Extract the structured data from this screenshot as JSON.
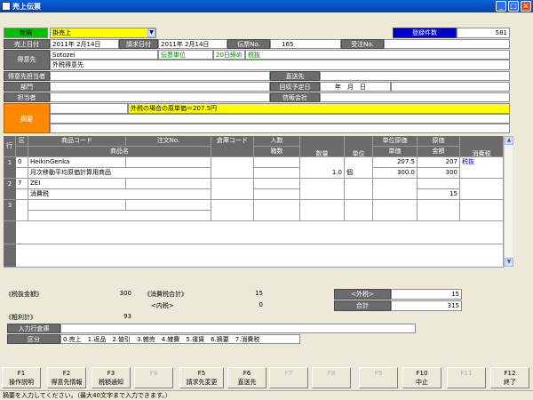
{
  "window": {
    "title": "売上伝票",
    "min": "_",
    "max": "□",
    "close": "×"
  },
  "header": {
    "mode": "新規",
    "type_value": "掛売上",
    "reg_count_label": "登録件数",
    "reg_count": "581",
    "sale_date_label": "売上日付",
    "sale_date": "2011年 2月14日",
    "bill_date_label": "請求日付",
    "bill_date": "2011年 2月14日",
    "slip_no_label": "伝票No.",
    "slip_no": "165",
    "order_no_label": "受注No.",
    "customer_label": "得意先",
    "customer_code": "Sotozei",
    "customer_unit": "伝票単位",
    "customer_close": "20日締め",
    "customer_tax": "税抜",
    "customer_name": "外税得意先",
    "contact_label": "得意先担当者",
    "dept_label": "部門",
    "staff_label": "担当者",
    "ship_label": "直送先",
    "collect_label": "回収予定日",
    "collect_value": "年　月　日",
    "trust_label": "信販会社",
    "memo_label": "摘要",
    "memo_text": "外税の場合の原単価＝207.5円"
  },
  "grid": {
    "h_row": "行",
    "h_kubun": "区",
    "h_code": "商品コード",
    "h_order": "注文No.",
    "h_name": "商品名",
    "h_warehouse": "倉庫コード",
    "h_irisu": "入数",
    "h_hako": "箱数",
    "h_qty": "数量",
    "h_unit": "単位",
    "h_unitcost_top": "単位原価",
    "h_unitcost_bot": "単価",
    "h_cost_top": "原価",
    "h_cost_bot": "金額",
    "h_tax": "消費税",
    "rows": [
      {
        "no": "1",
        "kubun": "0",
        "code": "HeikinGenka",
        "name": "月次移動平均原価計算用商品",
        "qty": "1.0",
        "unit": "個",
        "cost1": "207.5",
        "price": "300.0",
        "cost2": "207",
        "amount": "300",
        "tax": "税抜"
      },
      {
        "no": "2",
        "kubun": "7",
        "code": "ZEI",
        "name": "消費税",
        "amount": "15"
      },
      {
        "no": "3"
      }
    ]
  },
  "summary": {
    "taxex_label": "《税抜金額》",
    "taxex_value": "300",
    "taxsum_label": "《消費税合計》",
    "taxsum_value": "15",
    "intax_label": "<内税>",
    "intax_value": "0",
    "outtax_label": "<外税>",
    "outtax_value": "15",
    "total_label": "合計",
    "total_value": "315",
    "profit_label": "《粗利計》",
    "profit_value": "93",
    "inwh_label": "入力行倉庫",
    "kubun_label": "区分",
    "kubun_text": "0.売上　1.返品　2.値引　3.雑売　4.雑費　5.運賃　6.摘要　7.消費税"
  },
  "fkeys": [
    {
      "key": "F1",
      "label": "操作説明"
    },
    {
      "key": "F2",
      "label": "得意先情報"
    },
    {
      "key": "F3",
      "label": "税額通知"
    },
    {
      "key": "F4",
      "label": ""
    },
    {
      "key": "F5",
      "label": "請求先変更"
    },
    {
      "key": "F6",
      "label": "直送先"
    },
    {
      "key": "F7",
      "label": ""
    },
    {
      "key": "F8",
      "label": ""
    },
    {
      "key": "F9",
      "label": ""
    },
    {
      "key": "F10",
      "label": "中止"
    },
    {
      "key": "F11",
      "label": ""
    },
    {
      "key": "F12",
      "label": "終了"
    }
  ],
  "status": "摘要を入力してください。（最大40文字まで入力できます。）"
}
